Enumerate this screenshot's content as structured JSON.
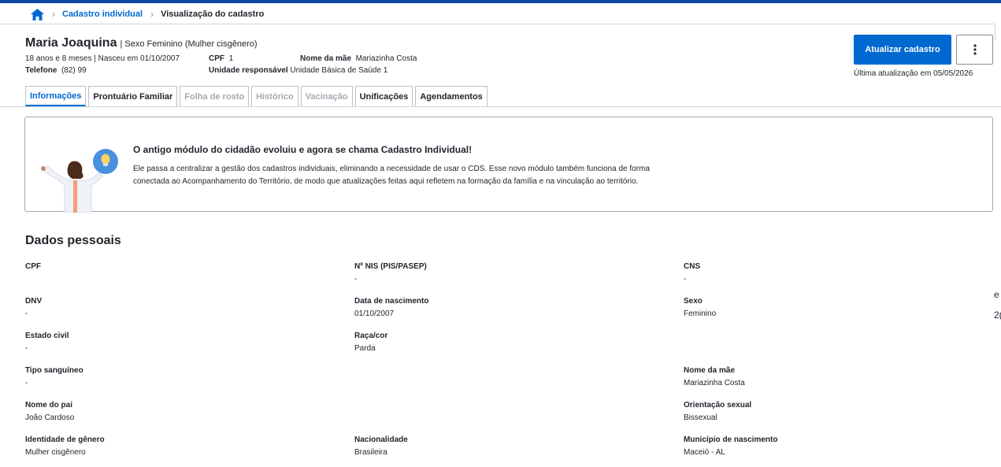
{
  "breadcrumb": {
    "home_icon": "home-icon",
    "link_label": "Cadastro individual",
    "current_label": "Visualização do cadastro"
  },
  "patient": {
    "name": "Maria Joaquina",
    "sex_label": "| Sexo Feminino  (Mulher cisgênero)",
    "age_birth": "18 anos e 8 meses | Nasceu em 01/10/2007",
    "cpf_label": "CPF",
    "cpf_value": "1",
    "mother_label": "Nome da mãe",
    "mother_value": "Mariazinha Costa",
    "phone_label": "Telefone",
    "phone_value": "(82) 99",
    "unit_label": "Unidade responsável",
    "unit_value": "Unidade Básica de Saúde 1"
  },
  "actions": {
    "update_button": "Atualizar cadastro",
    "more_icon": "more-vertical-icon",
    "last_update": "Última atualização em 05/05/2026"
  },
  "tabs": [
    {
      "label": "Informações",
      "state": "active"
    },
    {
      "label": "Prontuário Familiar",
      "state": "enabled"
    },
    {
      "label": "Folha de rosto",
      "state": "disabled"
    },
    {
      "label": "Histórico",
      "state": "disabled"
    },
    {
      "label": "Vacinação",
      "state": "disabled"
    },
    {
      "label": "Unificações",
      "state": "enabled"
    },
    {
      "label": "Agendamentos",
      "state": "enabled"
    }
  ],
  "banner": {
    "title": "O antigo módulo do cidadão evoluiu e agora se chama Cadastro Individual!",
    "text": "Ele passa a centralizar a gestão dos cadastros individuais, eliminando a necessidade de usar o CDS. Esse novo módulo também funciona de forma conectada ao Acompanhamento do Território, de modo que atualizações feitas aqui refletem na formação da família e na vinculação ao território."
  },
  "personal_data": {
    "title": "Dados pessoais",
    "fields": {
      "cpf": {
        "label": "CPF",
        "value": ""
      },
      "nis": {
        "label": "Nº NIS (PIS/PASEP)",
        "value": "-"
      },
      "cns": {
        "label": "CNS",
        "value": "-"
      },
      "dnv": {
        "label": "DNV",
        "value": "-"
      },
      "birth_date": {
        "label": "Data de nascimento",
        "value": "01/10/2007"
      },
      "sex": {
        "label": "Sexo",
        "value": "Feminino"
      },
      "marital_status": {
        "label": "Estado civil",
        "value": "-"
      },
      "race": {
        "label": "Raça/cor",
        "value": "Parda"
      },
      "blood_type": {
        "label": "Tipo sanguíneo",
        "value": "-"
      },
      "mother_name": {
        "label": "Nome da mãe",
        "value": "Mariazinha Costa"
      },
      "father_name": {
        "label": "Nome do pai",
        "value": "João Cardoso"
      },
      "sexual_orientation": {
        "label": "Orientação sexual",
        "value": "Bissexual"
      },
      "gender_identity": {
        "label": "Identidade de gênero",
        "value": "Mulher cisgênero"
      },
      "nationality": {
        "label": "Nacionalidade",
        "value": "Brasileira"
      },
      "birth_city": {
        "label": "Município de nascimento",
        "value": "Maceió - AL"
      }
    }
  },
  "edge_glyphs": {
    "first": "e",
    "second": "2("
  },
  "colors": {
    "primary": "#0069d0",
    "top_bar": "#0d47a1",
    "text": "#24252e",
    "disabled_text": "#a6a8b3",
    "bulb_circle": "#4a90e2"
  }
}
